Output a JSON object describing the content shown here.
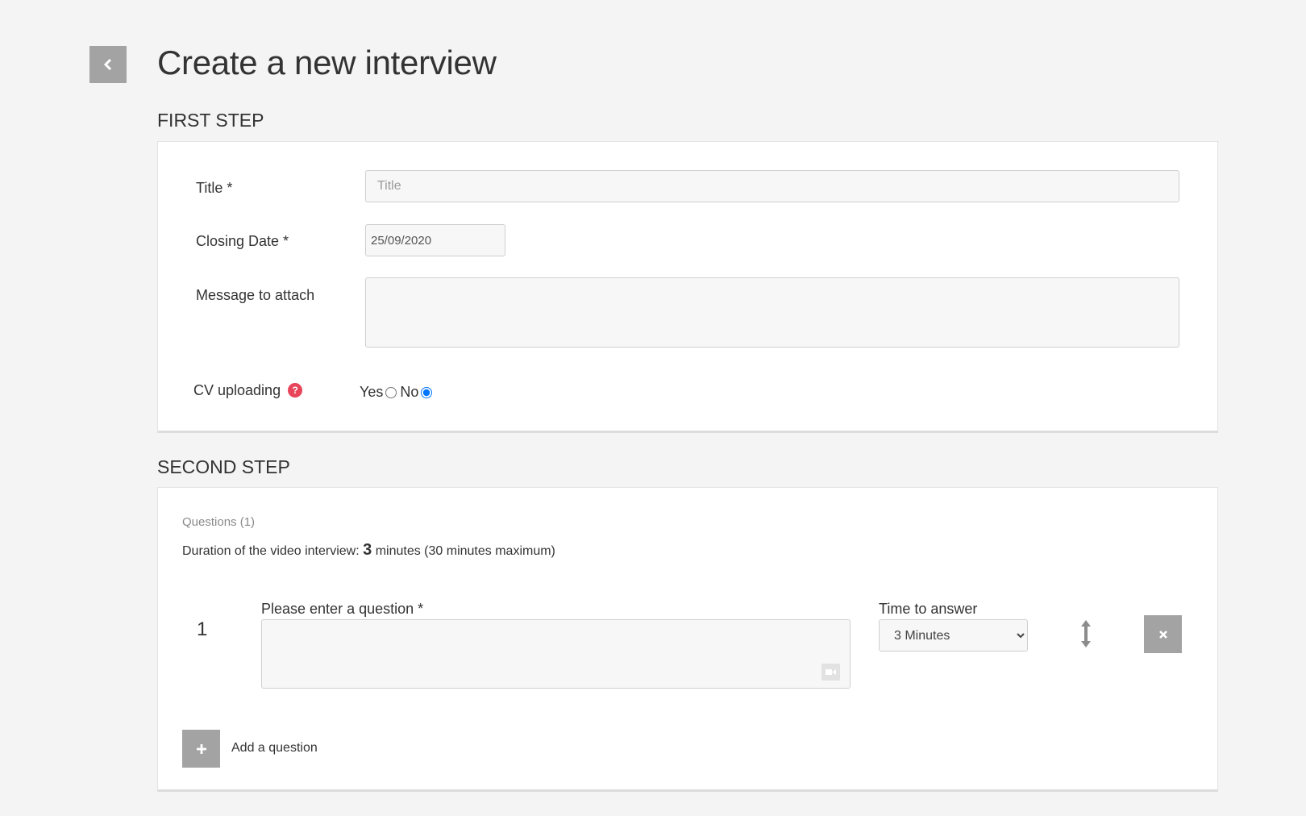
{
  "page": {
    "title": "Create a new interview"
  },
  "first_step": {
    "heading": "FIRST STEP",
    "title_label": "Title *",
    "title_placeholder": "Title",
    "title_value": "",
    "closing_date_label": "Closing Date *",
    "closing_date_value": "25/09/2020",
    "message_label": "Message to attach",
    "message_value": "",
    "cv_label": "CV uploading",
    "cv_help_icon": "question-circle",
    "cv_yes_label": "Yes",
    "cv_no_label": "No",
    "cv_selected": "No"
  },
  "second_step": {
    "heading": "SECOND STEP",
    "questions_count_label": "Questions (1)",
    "duration_prefix": "Duration of the video interview:",
    "duration_value": "3",
    "duration_suffix": "minutes (30 minutes maximum)",
    "questions": [
      {
        "number": "1",
        "question_label": "Please enter a question *",
        "question_value": "",
        "time_label": "Time to answer",
        "time_selected": "3 Minutes",
        "camera_icon": "video-camera"
      }
    ],
    "add_question_label": "Add a question"
  },
  "colors": {
    "background": "#f4f4f4",
    "button_gray": "#a3a3a3",
    "help_red": "#e8445a",
    "radio_blue": "#1a73e8"
  }
}
